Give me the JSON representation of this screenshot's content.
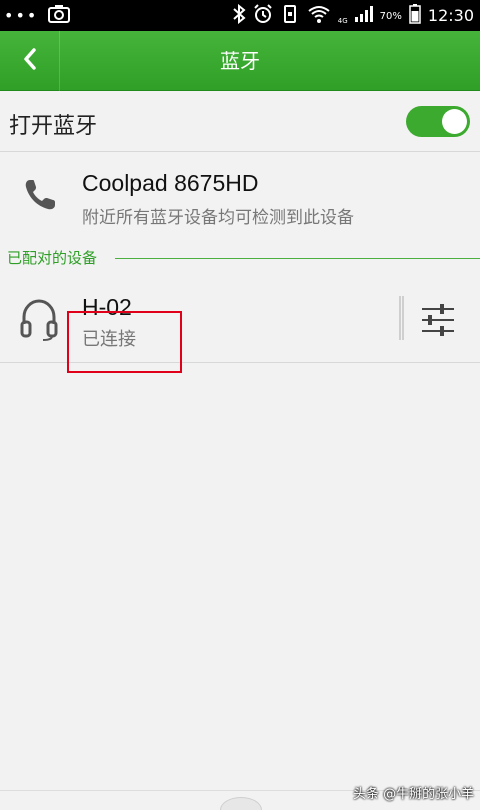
{
  "status_bar": {
    "time": "12:30",
    "battery_percent": "70%",
    "network": "4G",
    "icons": [
      "more-dots-icon",
      "screenshot-icon",
      "bluetooth-icon",
      "alarm-icon",
      "vibrate-icon",
      "wifi-icon",
      "signal-icon",
      "battery-icon"
    ]
  },
  "header": {
    "title": "蓝牙",
    "back_icon": "chevron-left-icon"
  },
  "bluetooth_toggle": {
    "label": "打开蓝牙",
    "state_on": true,
    "accent_color": "#3caa2e"
  },
  "this_device": {
    "name": "Coolpad 8675HD",
    "visibility": "附近所有蓝牙设备均可检测到此设备",
    "icon": "phone-icon"
  },
  "paired_section": {
    "label": "已配对的设备",
    "devices": [
      {
        "name": "H-02",
        "status": "已连接",
        "icon": "headset-icon",
        "settings_icon": "sliders-icon"
      }
    ]
  },
  "watermark": "头条 @牛掰的张小羊"
}
